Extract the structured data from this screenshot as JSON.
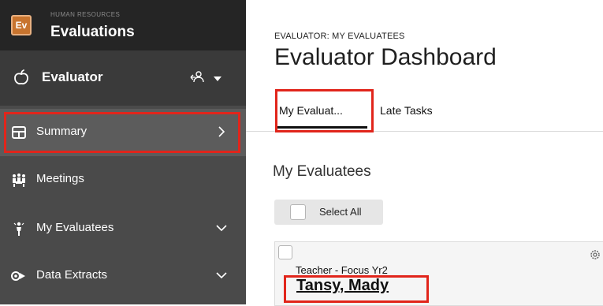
{
  "brand": {
    "logo_text": "Ev",
    "subtitle": "HUMAN RESOURCES",
    "title": "Evaluations"
  },
  "role": {
    "label": "Evaluator",
    "icon": "apple-icon",
    "switch_icon": "switch-role-icon"
  },
  "sidebar": {
    "items": [
      {
        "label": "Summary",
        "icon": "table-icon",
        "chevron": "chevron-right-icon",
        "active": true
      },
      {
        "label": "Meetings",
        "icon": "meetings-icon"
      },
      {
        "label": "My Evaluatees",
        "icon": "person-icon",
        "chevron": "chevron-down-icon"
      },
      {
        "label": "Data Extracts",
        "icon": "data-extract-icon",
        "chevron": "chevron-down-icon"
      }
    ]
  },
  "main": {
    "breadcrumb": "EVALUATOR: MY EVALUATEES",
    "title": "Evaluator Dashboard",
    "tabs": [
      {
        "label": "My Evaluat...",
        "active": true
      },
      {
        "label": "Late Tasks",
        "active": false
      }
    ],
    "section_title": "My Evaluatees",
    "select_all_label": "Select All",
    "evaluatee": {
      "role": "Teacher - Focus Yr2",
      "name": "Tansy, Mady",
      "settings_icon": "gear-icon"
    }
  },
  "colors": {
    "highlight": "#e1251b",
    "brand_orange": "#c8742e",
    "sidebar_bg": "#4a4a4a",
    "header_bg": "#252525"
  }
}
